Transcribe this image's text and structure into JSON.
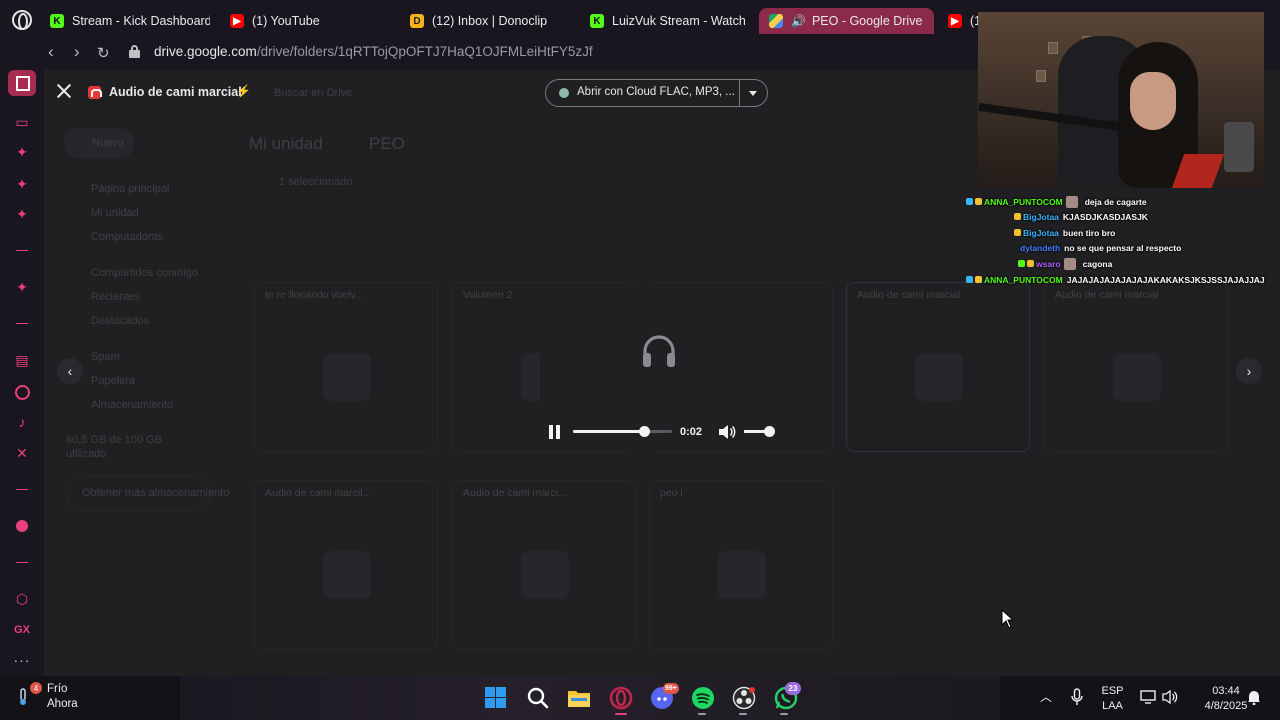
{
  "browser": {
    "tabs": [
      {
        "label": "Stream - Kick Dashboard",
        "icon": "kick-icon"
      },
      {
        "label": "(1) YouTube",
        "icon": "youtube-icon"
      },
      {
        "label": "(12) Inbox | Donoclip",
        "icon": "donoclip-icon"
      },
      {
        "label": "LuizVuk Stream - Watch",
        "icon": "kick-icon"
      },
      {
        "label": "PEO - Google Drive",
        "icon": "google-drive-icon",
        "active": true
      },
      {
        "label": "(1",
        "icon": "youtube-icon"
      }
    ],
    "url_host": "drive.google.com",
    "url_path": "/drive/folders/1qRTTojQpOFTJ7HaQ1OJFMLeiHtFY5zJf"
  },
  "viewer": {
    "file_title": "Audio de cami marcial",
    "open_with_label": "Abrir con Cloud FLAC, MP3, ...",
    "player": {
      "time": "0:02",
      "progress_fraction": 0.72,
      "volume_fraction": 0.9,
      "state": "playing"
    }
  },
  "background_drive": {
    "search_placeholder": "Buscar en Drive",
    "new_label": "Nuevo",
    "breadcrumb_root": "Mi unidad",
    "breadcrumb_folder": "PEO",
    "selection_text": "1 seleccionado",
    "nav": [
      "Página principal",
      "Mi unidad",
      "Computadoras",
      "Compartidos conmigo",
      "Recientes",
      "Destacados",
      "Spam",
      "Papelera",
      "Almacenamiento"
    ],
    "storage_text": "60,5 GB de 100 GB",
    "storage_sub": "utilizado",
    "storage_btn": "Obtener más almacenamiento",
    "files_row1": [
      "te re lloriando vuelv...",
      "Volumen 2",
      "Audio de cami marcial",
      "Audio de cami marcial"
    ],
    "files_row2": [
      "Audio de cami marcil...",
      "Audio de cami marci...",
      "peo i"
    ]
  },
  "stream_chat": [
    {
      "user": "ANNA_PUNTOCOM",
      "color": "#53fc18",
      "badges": [
        "blue",
        "gold"
      ],
      "emote": true,
      "msg": "deja de cagarte"
    },
    {
      "user": "BigJotaa",
      "color": "#3ab7ff",
      "badges": [
        "gold"
      ],
      "emote": false,
      "msg": "KJASDJKASDJASJK"
    },
    {
      "user": "BigJotaa",
      "color": "#3ab7ff",
      "badges": [
        "gold"
      ],
      "emote": false,
      "msg": "buen tiro bro"
    },
    {
      "user": "dylandeth",
      "color": "#4a7dff",
      "badges": [],
      "emote": false,
      "msg": "no se que pensar al respecto"
    },
    {
      "user": "wsaro",
      "color": "#b25cff",
      "badges": [
        "green",
        "gold"
      ],
      "emote": true,
      "msg": "cagona"
    },
    {
      "user": "ANNA_PUNTOCOM",
      "color": "#53fc18",
      "badges": [
        "blue",
        "gold"
      ],
      "emote": false,
      "msg": "JAJAJAJAJAJAJAJAKAKAKSJKSJSSJAJAJJAJ"
    }
  ],
  "sidebar": {
    "items": [
      "home-icon",
      "kick-studio-icon",
      "chatgpt-icon",
      "chatgpt-icon",
      "chatgpt-icon",
      "chatgpt-icon",
      "twitch-icon",
      "instagram-icon",
      "tiktok-icon",
      "x-icon",
      "music-icon",
      "settings-icon",
      "gx-icon",
      "more-icon"
    ],
    "gx_label": "GX",
    "more_label": "···"
  },
  "taskbar": {
    "weather_temp": "Frío",
    "weather_time": "Ahora",
    "weather_badge": "4",
    "discord_badge": "99+",
    "whatsapp_badge": "23",
    "language": "ESP",
    "layout": "LAA",
    "clock_time": "03:44",
    "clock_date": "4/8/2025"
  },
  "colors": {
    "accent": "#e8407a",
    "active_tab": "#8b2a4a",
    "kick_green": "#53fc18"
  }
}
